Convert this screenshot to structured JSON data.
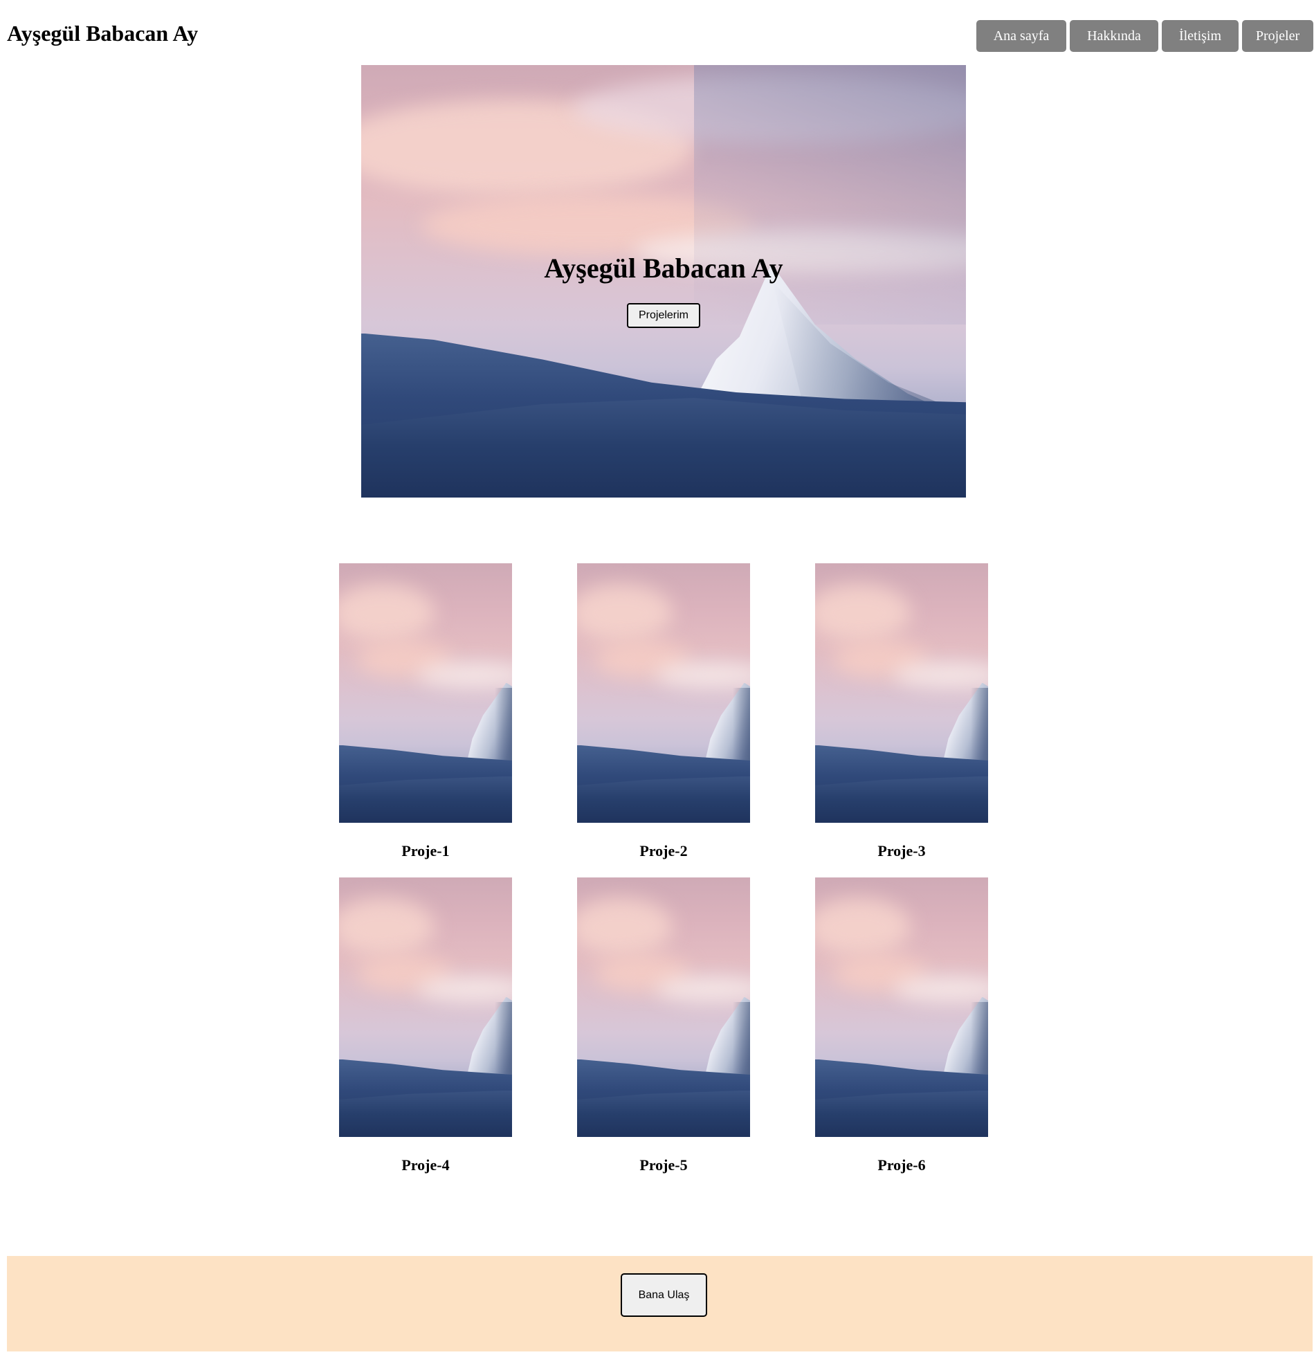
{
  "header": {
    "site_title": "Ayşegül Babacan Ay",
    "nav": [
      {
        "label": "Ana sayfa"
      },
      {
        "label": "Hakkında"
      },
      {
        "label": "İletişim"
      },
      {
        "label": "Projeler"
      }
    ]
  },
  "hero": {
    "image": "mountain-landscape-image",
    "title": "Ayşegül Babacan Ay",
    "button_label": "Projelerim"
  },
  "projects": [
    {
      "title": "Proje-1",
      "image": "mountain-landscape-image"
    },
    {
      "title": "Proje-2",
      "image": "mountain-landscape-image"
    },
    {
      "title": "Proje-3",
      "image": "mountain-landscape-image"
    },
    {
      "title": "Proje-4",
      "image": "mountain-landscape-image"
    },
    {
      "title": "Proje-5",
      "image": "mountain-landscape-image"
    },
    {
      "title": "Proje-6",
      "image": "mountain-landscape-image"
    }
  ],
  "footer": {
    "button_label": "Bana Ulaş"
  },
  "colors": {
    "nav_button_bg": "#808080",
    "nav_button_text": "#ffffff",
    "footer_bg": "#fde2c4",
    "button_bg": "#efefef",
    "button_border": "#000000"
  }
}
